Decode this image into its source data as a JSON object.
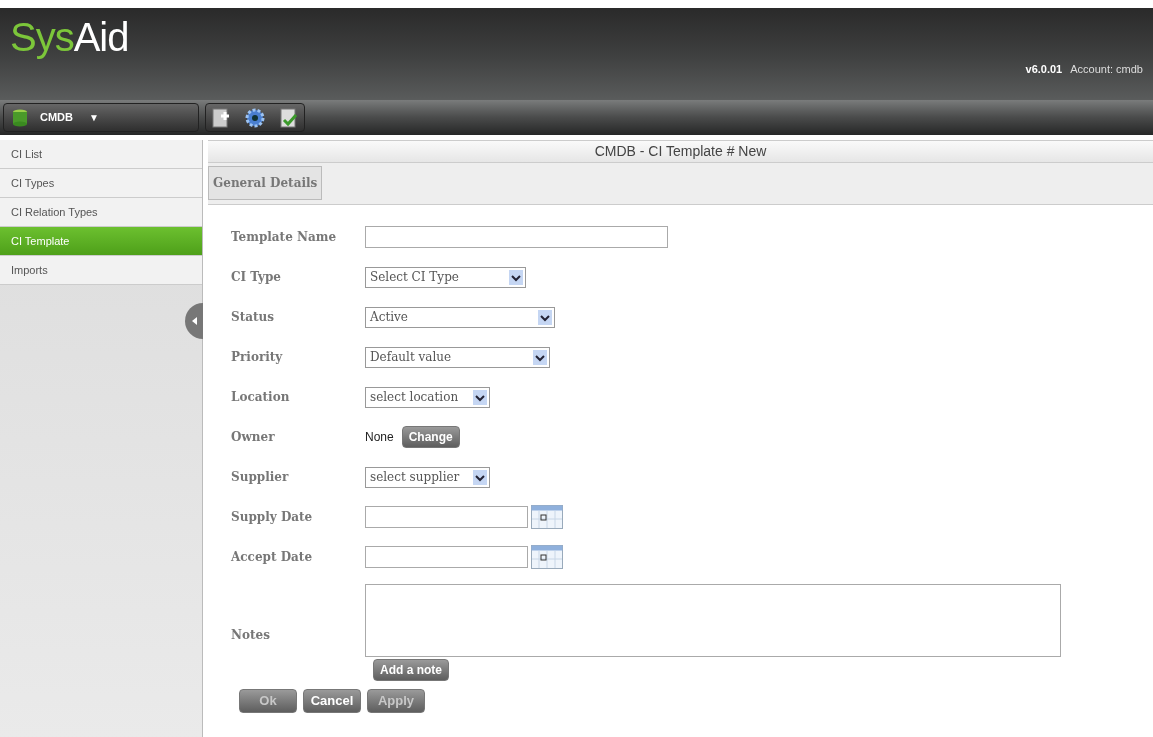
{
  "header": {
    "logo": [
      "Sys",
      "Aid"
    ],
    "version": "v6.0.01",
    "account": "Account: cmdb"
  },
  "module_menu": {
    "label": "CMDB",
    "caret": "▼"
  },
  "sidebar": {
    "items": [
      {
        "label": "CI List",
        "selected": false
      },
      {
        "label": "CI Types",
        "selected": false
      },
      {
        "label": "CI Relation Types",
        "selected": false
      },
      {
        "label": "CI Template",
        "selected": true
      },
      {
        "label": "Imports",
        "selected": false
      }
    ]
  },
  "page_title": "CMDB - CI Template # New",
  "tabs": [
    {
      "label": "General Details",
      "selected": true
    }
  ],
  "form": {
    "fields": [
      {
        "kind": "text",
        "label": "Template Name"
      },
      {
        "kind": "select",
        "label": "CI Type",
        "value": "Select CI Type"
      },
      {
        "kind": "select",
        "label": "Status",
        "value": "Active"
      },
      {
        "kind": "select",
        "label": "Priority",
        "value": "Default value"
      },
      {
        "kind": "select",
        "label": "Location",
        "value": "select location"
      },
      {
        "kind": "owner",
        "label": "Owner",
        "value": "None",
        "button": "Change"
      },
      {
        "kind": "select",
        "label": "Supplier",
        "value": "select supplier"
      },
      {
        "kind": "date",
        "label": "Supply Date"
      },
      {
        "kind": "date",
        "label": "Accept Date"
      },
      {
        "kind": "textarea",
        "label": "Notes",
        "button": "Add a note"
      }
    ]
  },
  "buttons": [
    {
      "label": "Ok",
      "disabled": true
    },
    {
      "label": "Cancel",
      "disabled": false
    },
    {
      "label": "Apply",
      "disabled": true
    }
  ]
}
